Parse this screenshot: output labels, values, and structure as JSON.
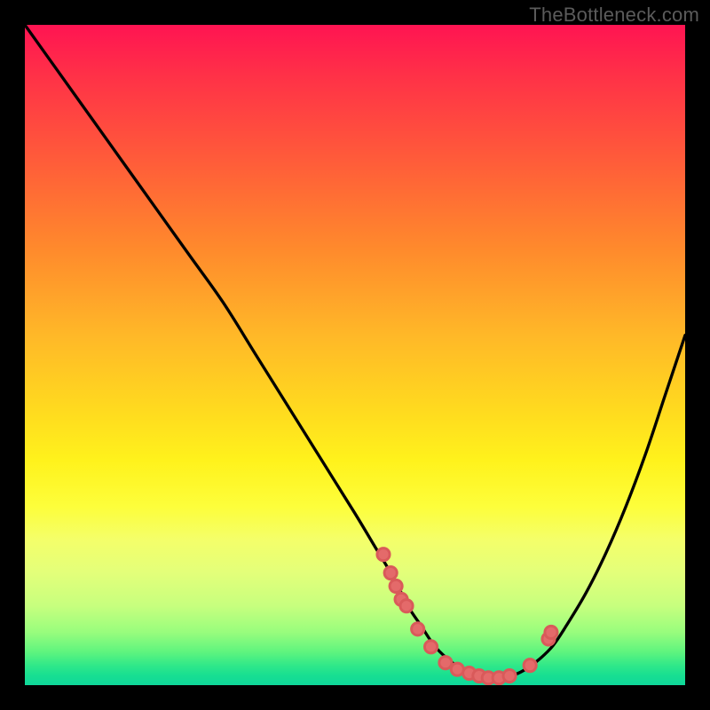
{
  "watermark": "TheBottleneck.com",
  "chart_data": {
    "type": "line",
    "title": "",
    "xlabel": "",
    "ylabel": "",
    "xlim": [
      0,
      100
    ],
    "ylim": [
      0,
      100
    ],
    "grid": false,
    "series": [
      {
        "name": "curve",
        "x": [
          0,
          5,
          10,
          15,
          20,
          25,
          30,
          35,
          40,
          45,
          50,
          53,
          56,
          58,
          60,
          62,
          64,
          66,
          68,
          70,
          72,
          74,
          76,
          78,
          80,
          82,
          85,
          88,
          91,
          94,
          97,
          100
        ],
        "y": [
          100,
          93,
          86,
          79,
          72,
          65,
          58,
          50,
          42,
          34,
          26,
          21,
          16,
          12,
          9,
          6,
          4,
          2.5,
          1.5,
          1,
          1,
          1.5,
          2.5,
          4,
          6,
          9,
          14,
          20,
          27,
          35,
          44,
          53
        ]
      },
      {
        "name": "dots",
        "x": [
          54.3,
          55.4,
          56.2,
          57.0,
          57.8,
          59.5,
          61.5,
          63.7,
          65.5,
          67.3,
          68.8,
          70.2,
          71.8,
          73.4,
          76.5,
          79.3,
          79.7
        ],
        "y": [
          19.8,
          17.0,
          15.0,
          13.0,
          12.0,
          8.5,
          5.8,
          3.4,
          2.4,
          1.8,
          1.4,
          1.1,
          1.1,
          1.4,
          3.0,
          7.0,
          8.0
        ]
      }
    ],
    "colors": {
      "curve": "#000000",
      "dots": "#e46a6a",
      "background_top": "#ff1452",
      "background_bottom": "#0fd79a"
    }
  }
}
